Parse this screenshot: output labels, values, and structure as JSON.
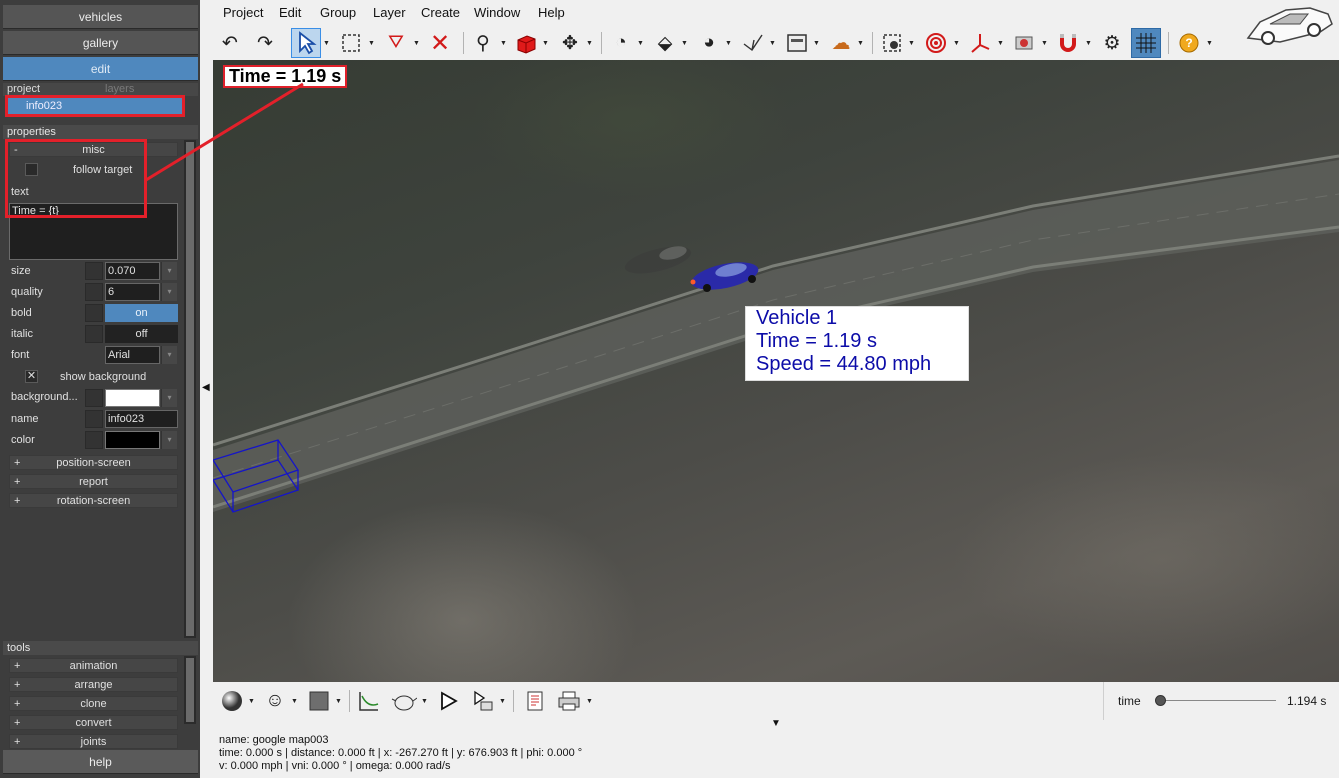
{
  "left_panel": {
    "nav_vehicles": "vehicles",
    "nav_gallery": "gallery",
    "nav_edit": "edit",
    "tab_project": "project",
    "tab_layers": "layers",
    "selected_item": "info023",
    "properties_header": "properties",
    "misc": {
      "sign": "-",
      "label": "misc"
    },
    "follow_target_label": "follow target",
    "text_label": "text",
    "text_value": "Time = {t}",
    "size_label": "size",
    "size_value": "0.070",
    "quality_label": "quality",
    "quality_value": "6",
    "bold_label": "bold",
    "bold_value": "on",
    "italic_label": "italic",
    "italic_value": "off",
    "font_label": "font",
    "font_value": "Arial",
    "show_background_label": "show background",
    "background_label": "background...",
    "name_label": "name",
    "name_value": "info023",
    "color_label": "color",
    "sections": [
      {
        "sign": "+",
        "label": "position-screen"
      },
      {
        "sign": "+",
        "label": "report"
      },
      {
        "sign": "+",
        "label": "rotation-screen"
      }
    ],
    "tools_header": "tools",
    "tools": [
      {
        "sign": "+",
        "label": "animation"
      },
      {
        "sign": "+",
        "label": "arrange"
      },
      {
        "sign": "+",
        "label": "clone"
      },
      {
        "sign": "+",
        "label": "convert"
      },
      {
        "sign": "+",
        "label": "joints"
      }
    ],
    "help": "help"
  },
  "menu": [
    "Project",
    "Edit",
    "Group",
    "Layer",
    "Create",
    "Window",
    "Help"
  ],
  "toolbar_icons": [
    "undo-icon",
    "redo-icon",
    "select-arrow-icon",
    "rect-select-icon",
    "filter-select-icon",
    "delete-icon",
    "zoom-icon",
    "cube-icon",
    "move-icon",
    "measure-icon",
    "ruler-icon",
    "dial-icon",
    "polygon-icon",
    "panel-icon",
    "splat-icon",
    "camera-target-icon",
    "target-icon",
    "axis-icon",
    "render-icon",
    "magnet-icon",
    "settings-icon",
    "grid-icon",
    "help-icon"
  ],
  "viewport": {
    "time_overlay": "Time = 1.19 s",
    "info_lines": [
      "Vehicle 1",
      "Time = 1.19 s",
      "Speed = 44.80 mph"
    ]
  },
  "bottom": {
    "time_label": "time",
    "time_value": "1.194 s",
    "time_slider_position": 0.0
  },
  "status": {
    "line1": "name: google map003",
    "line2": "time: 0.000 s | distance: 0.000 ft | x: -267.270 ft | y: 676.903 ft | phi: 0.000 °",
    "line3": "v: 0.000 mph | vni: 0.000 ° | omega: 0.000 rad/s"
  },
  "colors": {
    "accent_blue": "#4f88be",
    "annotation_red": "#e3202a",
    "info_text": "#0c0ca8",
    "panel_bg": "#3d3d3d"
  }
}
